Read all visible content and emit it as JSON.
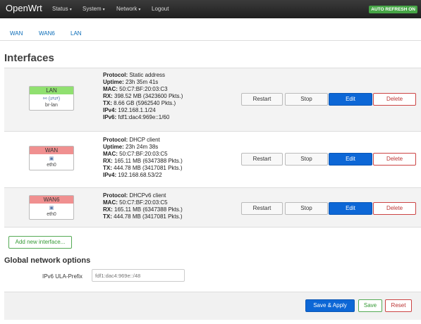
{
  "navbar": {
    "brand": "OpenWrt",
    "menus": [
      "Status",
      "System",
      "Network",
      "Logout"
    ],
    "auto_refresh": "AUTO REFRESH ON"
  },
  "tabs": [
    "WAN",
    "WAN6",
    "LAN"
  ],
  "page_title": "Interfaces",
  "interfaces": [
    {
      "name": "LAN",
      "device": "br-lan",
      "header_color": "#90e070",
      "icon": "bridge-icon",
      "lines": [
        [
          "Protocol:",
          "Static address"
        ],
        [
          "Uptime:",
          "23h 35m 41s"
        ],
        [
          "MAC:",
          "50:C7:BF:20:03:C3"
        ],
        [
          "RX:",
          "398.52 MB (3423600 Pkts.)"
        ],
        [
          "TX:",
          "8.66 GB (5962540 Pkts.)"
        ],
        [
          "IPv4:",
          "192.168.1.1/24"
        ],
        [
          "IPv6:",
          "fdf1:dac4:969e::1/60"
        ]
      ]
    },
    {
      "name": "WAN",
      "device": "eth0",
      "header_color": "#f09090",
      "icon": "ethernet-port-icon",
      "lines": [
        [
          "Protocol:",
          "DHCP client"
        ],
        [
          "Uptime:",
          "23h 24m 38s"
        ],
        [
          "MAC:",
          "50:C7:BF:20:03:C5"
        ],
        [
          "RX:",
          "165.11 MB (6347388 Pkts.)"
        ],
        [
          "TX:",
          "444.78 MB (3417081 Pkts.)"
        ],
        [
          "IPv4:",
          "192.168.68.53/22"
        ]
      ]
    },
    {
      "name": "WAN6",
      "device": "eth0",
      "header_color": "#f09090",
      "icon": "ethernet-port-icon",
      "lines": [
        [
          "Protocol:",
          "DHCPv6 client"
        ],
        [
          "MAC:",
          "50:C7:BF:20:03:C5"
        ],
        [
          "RX:",
          "165.11 MB (6347388 Pkts.)"
        ],
        [
          "TX:",
          "444.78 MB (3417081 Pkts.)"
        ]
      ]
    }
  ],
  "row_buttons": {
    "restart": "Restart",
    "stop": "Stop",
    "edit": "Edit",
    "delete": "Delete"
  },
  "add_interface": "Add new interface...",
  "global_section": {
    "title": "Global network options",
    "ula_label": "IPv6 ULA-Prefix",
    "ula_value": "fdf1:dac4:969e::/48"
  },
  "footer": {
    "save_apply": "Save & Apply",
    "save": "Save",
    "reset": "Reset"
  }
}
